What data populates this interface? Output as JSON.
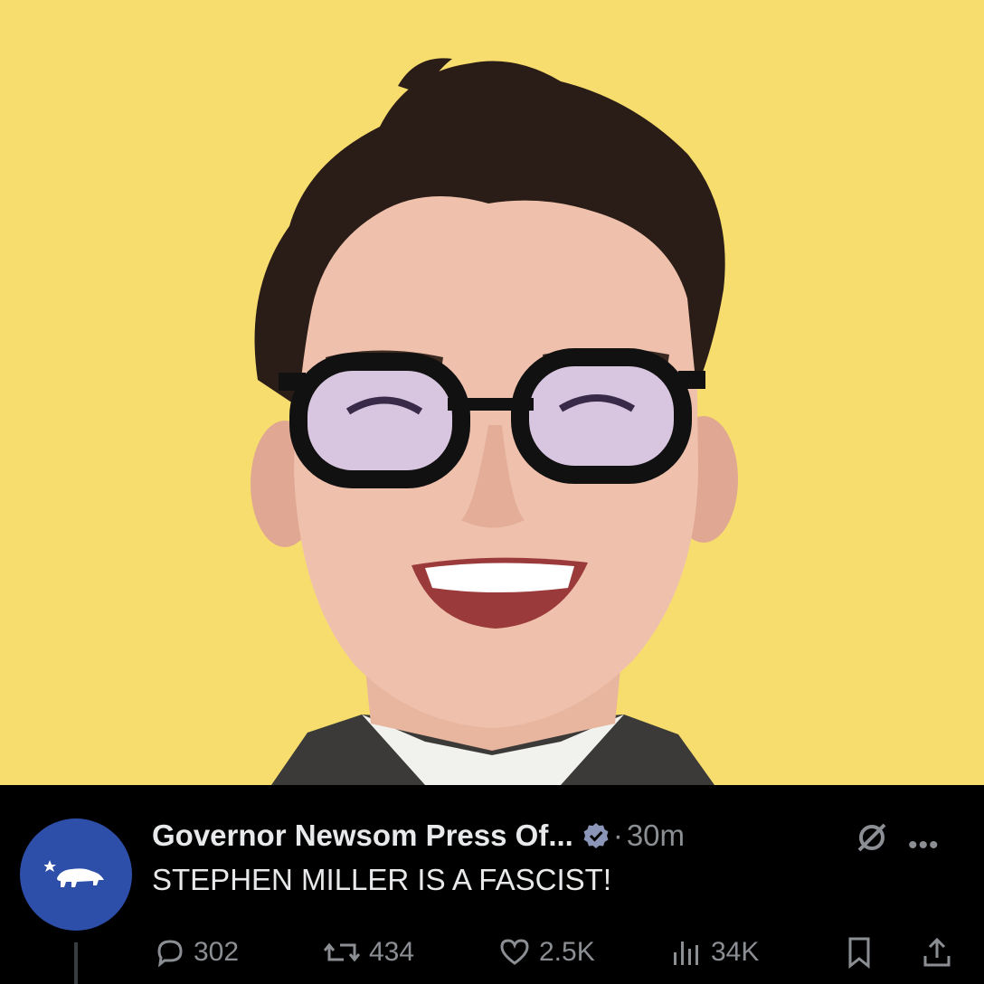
{
  "post": {
    "display_name": "Governor Newsom Press Of...",
    "dot": "·",
    "time": "30m",
    "text": "STEPHEN MILLER IS A FASCIST!",
    "avatar_icon": "california-bear-icon",
    "stats": {
      "replies": "302",
      "reposts": "434",
      "likes": "2.5K",
      "views": "34K"
    }
  },
  "colors": {
    "photo_background": "#f7dd6e",
    "avatar_background": "#2d4faa",
    "verified_badge": "#8b95b8",
    "muted_text": "#8b8f94"
  }
}
